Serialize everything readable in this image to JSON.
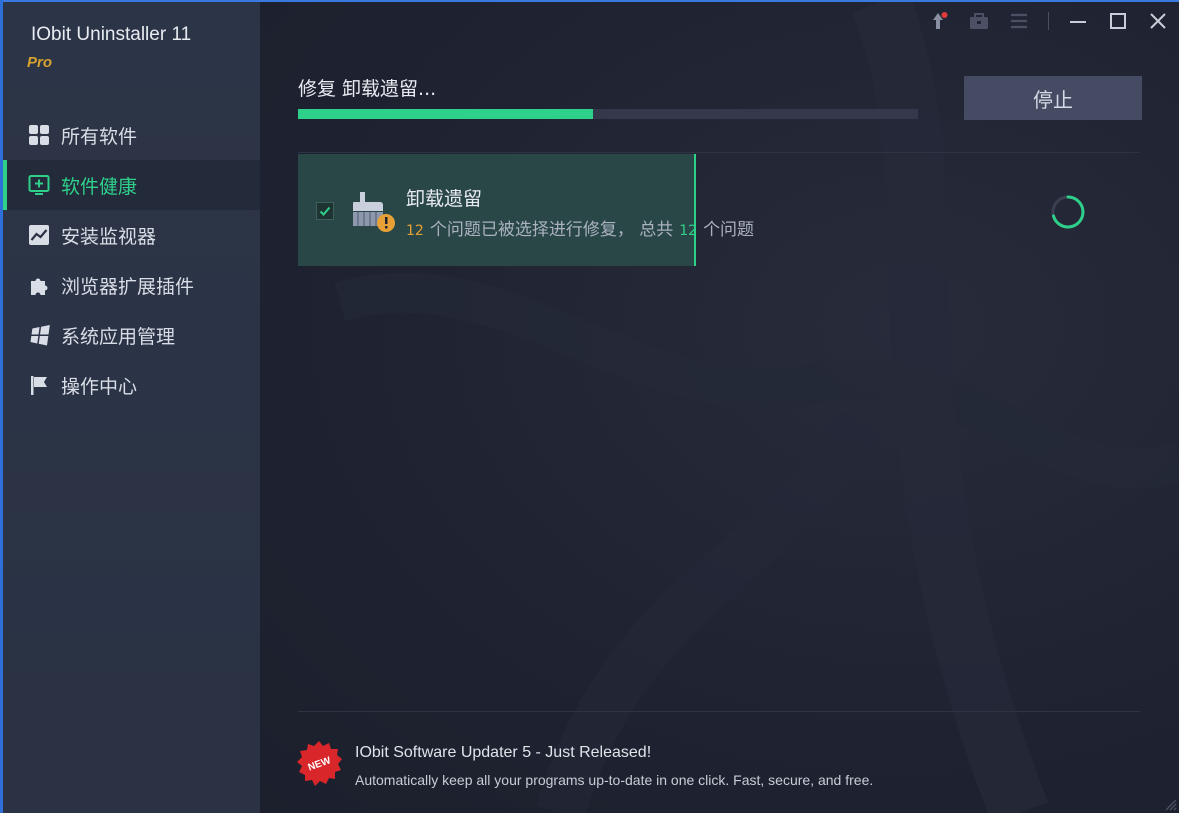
{
  "app": {
    "title": "IObit Uninstaller 11",
    "edition": "Pro"
  },
  "sidebar": {
    "items": [
      {
        "label": "所有软件",
        "icon": "grid-icon",
        "active": false
      },
      {
        "label": "软件健康",
        "icon": "monitor-plus-icon",
        "active": true
      },
      {
        "label": "安装监视器",
        "icon": "chart-line-icon",
        "active": false
      },
      {
        "label": "浏览器扩展插件",
        "icon": "puzzle-icon",
        "active": false
      },
      {
        "label": "系统应用管理",
        "icon": "windows-icon",
        "active": false
      },
      {
        "label": "操作中心",
        "icon": "flag-icon",
        "active": false
      }
    ]
  },
  "titlebar": {
    "icons": [
      "notification-icon",
      "toolbox-icon",
      "menu-icon",
      "minimize-icon",
      "maximize-icon",
      "close-icon"
    ]
  },
  "progress": {
    "title": "修复 卸载遗留...",
    "fraction": 0.475
  },
  "stop_button": {
    "label": "停止"
  },
  "task": {
    "name": "卸载遗留",
    "selected_count": "12",
    "selected_text": "个问题已被选择进行修复，  总共",
    "total_count": "12",
    "total_text": "个问题",
    "checked": true
  },
  "promo": {
    "badge_text": "NEW",
    "title": "IObit Software Updater 5 - Just Released!",
    "description": "Automatically keep all your programs up-to-date in one click. Fast, secure, and free."
  },
  "colors": {
    "accent": "#2fd08a",
    "warning": "#e7a035",
    "pro": "#d8a22e"
  }
}
